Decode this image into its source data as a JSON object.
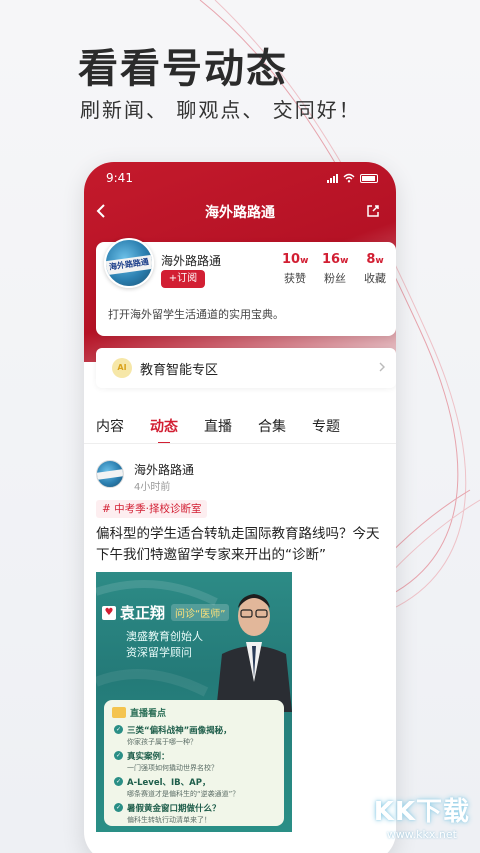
{
  "promo": {
    "headline": "看看号动态",
    "subline": "刷新闻、 聊观点、 交同好！"
  },
  "status_bar": {
    "time": "9:41"
  },
  "nav": {
    "title": "海外路路通"
  },
  "profile": {
    "name": "海外路路通",
    "avatar_text": "海外路路通",
    "follow_label": "+订阅",
    "stats": [
      {
        "value": "10",
        "unit": "w",
        "label": "获赞"
      },
      {
        "value": "16",
        "unit": "w",
        "label": "粉丝"
      },
      {
        "value": "8",
        "unit": "w",
        "label": "收藏"
      }
    ],
    "bio": "打开海外留学生活通道的实用宝典。"
  },
  "ai_zone": {
    "icon_text": "AI",
    "label": "教育智能专区"
  },
  "tabs": [
    {
      "label": "内容",
      "active": false
    },
    {
      "label": "动态",
      "active": true
    },
    {
      "label": "直播",
      "active": false
    },
    {
      "label": "合集",
      "active": false
    },
    {
      "label": "专题",
      "active": false
    }
  ],
  "post": {
    "author": "海外路路通",
    "time": "4小时前",
    "tag": "# 中考季·择校诊断室",
    "text": "偏科型的学生适合转轨走国际教育路线吗？今天下午我们特邀留学专家来开出的“诊断”",
    "image": {
      "name": "袁正翔",
      "name_tag": "问诊“医师”",
      "roles": [
        "澳盛教育创始人",
        "资深留学顾问"
      ],
      "panel_title": "直播看点",
      "items": [
        {
          "title": "三类“偏科战神”画像揭秘，",
          "sub": "你家孩子属于哪一种？"
        },
        {
          "title": "真实案例：",
          "sub": "一门强项如何撬动世界名校？"
        },
        {
          "title": "A-Level、IB、AP，",
          "sub": "哪条赛道才是偏科生的“逆袭通道”？"
        },
        {
          "title": "暑假黄金窗口期做什么？",
          "sub": "偏科生转轨行动清单来了！"
        }
      ]
    }
  },
  "watermark": {
    "big": "KK下载",
    "small": "www.kkx.net"
  },
  "colors": {
    "brand_red": "#d21f33",
    "header_red": "#c41a2c",
    "image_teal": "#2d8b86"
  }
}
